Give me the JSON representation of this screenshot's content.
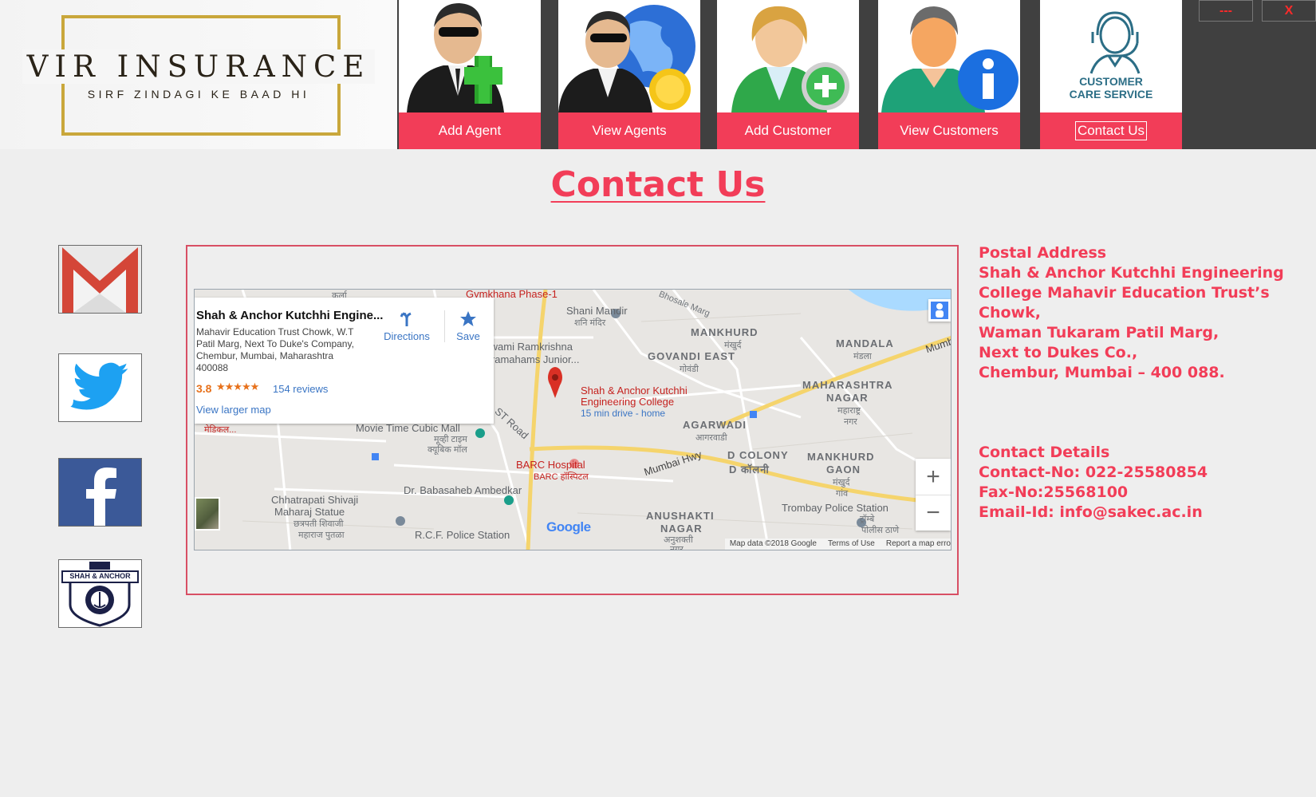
{
  "logo": {
    "title": "VIR INSURANCE",
    "subtitle": "SIRF ZINDAGI KE BAAD HI"
  },
  "nav": {
    "items": [
      {
        "label": "Add Agent",
        "icon": "add-agent-icon"
      },
      {
        "label": "View Agents",
        "icon": "view-agents-icon"
      },
      {
        "label": "Add Customer",
        "icon": "add-customer-icon"
      },
      {
        "label": "View Customers",
        "icon": "view-customers-icon"
      },
      {
        "label": "Contact Us",
        "icon": "customer-care-icon",
        "active": true
      }
    ],
    "care_text_1": "CUSTOMER",
    "care_text_2": "CARE SERVICE"
  },
  "window": {
    "minimize_label": "---",
    "close_label": "X"
  },
  "page": {
    "title": "Contact Us"
  },
  "social": [
    "gmail-icon",
    "twitter-icon",
    "facebook-icon",
    "shah-anchor-logo"
  ],
  "social_logo_text": "SHAH & ANCHOR",
  "map": {
    "place_title": "Shah & Anchor Kutchhi Engine...",
    "place_address": "Mahavir Education Trust Chowk, W.T Patil Marg, Next To Duke's Company, Chembur, Mumbai, Maharashtra 400088",
    "rating": "3.8",
    "stars": "★★★★★",
    "reviews": "154 reviews",
    "view_larger": "View larger map",
    "directions": "Directions",
    "save": "Save",
    "marker_label_1": "Shah & Anchor Kutchhi",
    "marker_label_2": "Engineering College",
    "marker_drive": "15 min drive - home",
    "labels": {
      "gymkhana": "Gymkhana Phase-1",
      "kurla": "कुर्ला",
      "shani": "Shani Mandir",
      "shani_dev": "शनि मंदिर",
      "mankhurd": "MANKHURD",
      "mankhurd_dev": "मंखुर्द",
      "mandala": "MANDALA",
      "mandala_dev": "मंडला",
      "swami": "Swami Ramkrishna",
      "paramhans": "Paramahams Junior...",
      "govandi": "GOVANDI EAST",
      "govandi_dev": "गोवंडी",
      "bhosale": "Bhosale Marg",
      "maharashtra_nagar_1": "MAHARASHTRA",
      "maharashtra_nagar_2": "NAGAR",
      "maharashtra_dev_1": "महाराष्ट्र",
      "maharashtra_dev_2": "नगर",
      "agarwadi": "AGARWADI",
      "agarwadi_dev": "आगरवाडी",
      "st_road": "ST Road",
      "movie_time": "Movie Time Cubic Mall",
      "movie_dev_1": "मूव्ही टाइम",
      "movie_dev_2": "क्यूबिक मॉल",
      "medical": "मेडिकल...",
      "mumbai_hwy": "Mumbai Hwy",
      "mumbai_edge": "Mumb",
      "d_colony": "D COLONY",
      "d_colony_dev": "D कॉलनी",
      "mankhurd_gaon_1": "MANKHURD",
      "mankhurd_gaon_2": "GAON",
      "mankhurd_gaon_dev_1": "मंखुर्द",
      "mankhurd_gaon_dev_2": "गांव",
      "barc": "BARC Hospital",
      "barc_dev": "BARC हॉस्पिटल",
      "ambedkar": "Dr. Babasaheb Ambedkar",
      "chhatrapati_1": "Chhatrapati Shivaji",
      "chhatrapati_2": "Maharaj Statue",
      "chhatrapati_dev_1": "छत्रपती शिवाजी",
      "chhatrapati_dev_2": "महाराज पुतळा",
      "rcf": "R.C.F. Police Station",
      "trombay": "Trombay Police Station",
      "trombay_dev": "ट्रॉम्बे",
      "police_dev": "पोलीस ठाणे",
      "anushakti_1": "ANUSHAKTI",
      "anushakti_2": "NAGAR",
      "anushakti_dev_1": "अनुशक्ती",
      "anushakti_dev_2": "नगर"
    },
    "google": "Google",
    "footer": {
      "data": "Map data ©2018 Google",
      "terms": "Terms of Use",
      "report": "Report a map erro"
    },
    "zoom_in": "+",
    "zoom_out": "−"
  },
  "contact": {
    "postal_heading": "Postal Address",
    "postal_lines": [
      "Shah & Anchor Kutchhi Engineering",
      "College Mahavir Education Trust’s",
      "Chowk,",
      "Waman Tukaram Patil Marg,",
      "Next to Dukes Co.,",
      "Chembur, Mumbai – 400 088."
    ],
    "details_heading": "Contact Details",
    "details_lines": [
      "Contact-No: 022-25580854",
      "Fax-No:25568100",
      "Email-Id: info@sakec.ac.in"
    ]
  },
  "colors": {
    "accent": "#f23d58",
    "header_dark": "#404040",
    "logo_gold": "#c9a73b",
    "background": "#eeeeee"
  }
}
